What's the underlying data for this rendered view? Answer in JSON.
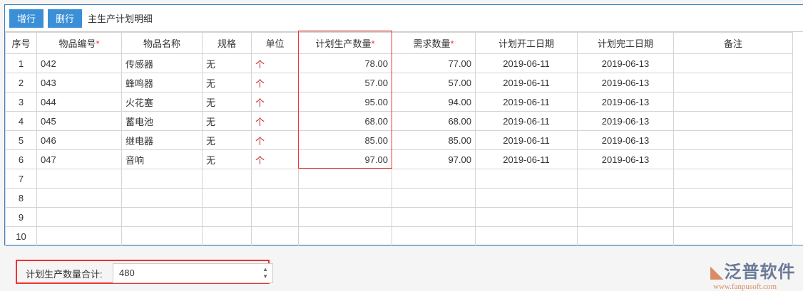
{
  "toolbar": {
    "add_row": "增行",
    "delete_row": "删行",
    "caption": "主生产计划明细"
  },
  "columns": [
    "序号",
    "物品编号",
    "物品名称",
    "规格",
    "单位",
    "计划生产数量",
    "需求数量",
    "计划开工日期",
    "计划完工日期",
    "备注"
  ],
  "required_mark": "*",
  "rows": [
    {
      "no": "1",
      "code": "042",
      "name": "传感器",
      "spec": "无",
      "unit": "个",
      "plan": "78.00",
      "demand": "77.00",
      "start": "2019-06-11",
      "end": "2019-06-13",
      "note": ""
    },
    {
      "no": "2",
      "code": "043",
      "name": "蜂鸣器",
      "spec": "无",
      "unit": "个",
      "plan": "57.00",
      "demand": "57.00",
      "start": "2019-06-11",
      "end": "2019-06-13",
      "note": ""
    },
    {
      "no": "3",
      "code": "044",
      "name": "火花塞",
      "spec": "无",
      "unit": "个",
      "plan": "95.00",
      "demand": "94.00",
      "start": "2019-06-11",
      "end": "2019-06-13",
      "note": ""
    },
    {
      "no": "4",
      "code": "045",
      "name": "蓄电池",
      "spec": "无",
      "unit": "个",
      "plan": "68.00",
      "demand": "68.00",
      "start": "2019-06-11",
      "end": "2019-06-13",
      "note": ""
    },
    {
      "no": "5",
      "code": "046",
      "name": "继电器",
      "spec": "无",
      "unit": "个",
      "plan": "85.00",
      "demand": "85.00",
      "start": "2019-06-11",
      "end": "2019-06-13",
      "note": ""
    },
    {
      "no": "6",
      "code": "047",
      "name": "音响",
      "spec": "无",
      "unit": "个",
      "plan": "97.00",
      "demand": "97.00",
      "start": "2019-06-11",
      "end": "2019-06-13",
      "note": ""
    },
    {
      "no": "7"
    },
    {
      "no": "8"
    },
    {
      "no": "9"
    },
    {
      "no": "10"
    }
  ],
  "summary": {
    "label": "计划生产数量合计:",
    "value": "480"
  },
  "logo": {
    "name": "泛普软件",
    "url": "www.fanpusoft.com"
  }
}
